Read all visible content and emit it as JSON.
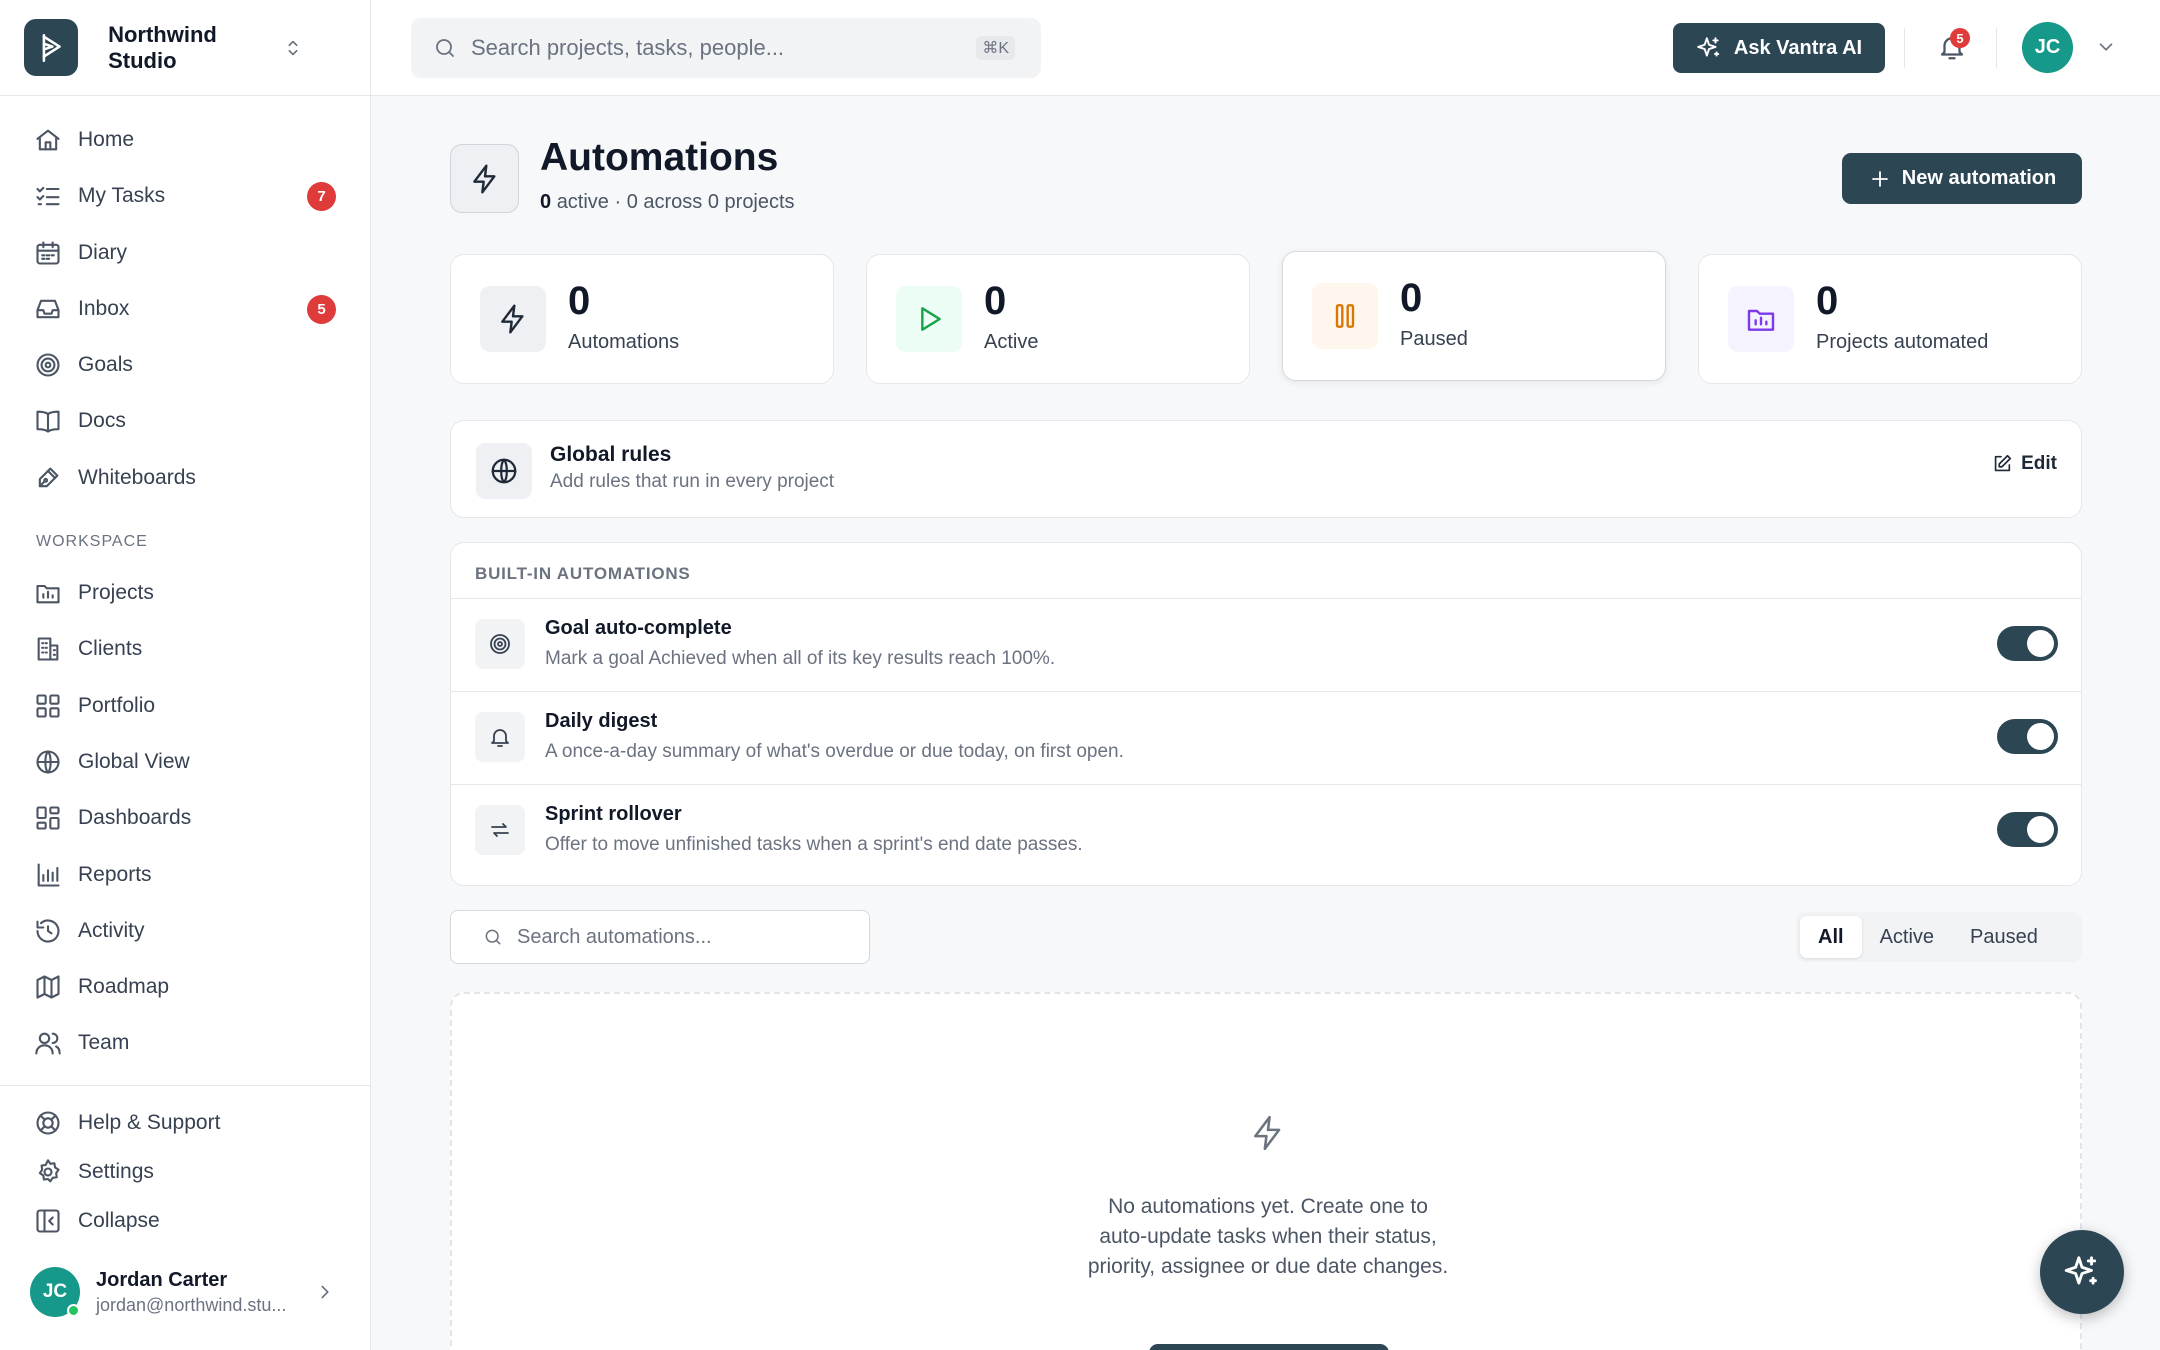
{
  "workspace": {
    "name": "Northwind Studio"
  },
  "nav": {
    "items": [
      {
        "label": "Home",
        "icon": "home-icon"
      },
      {
        "label": "My Tasks",
        "icon": "list-check-icon",
        "badge": "7"
      },
      {
        "label": "Diary",
        "icon": "calendar-icon"
      },
      {
        "label": "Inbox",
        "icon": "inbox-icon",
        "badge": "5"
      },
      {
        "label": "Goals",
        "icon": "target-icon"
      },
      {
        "label": "Docs",
        "icon": "book-icon"
      },
      {
        "label": "Whiteboards",
        "icon": "pen-icon"
      }
    ],
    "section_title": "WORKSPACE",
    "workspace_items": [
      {
        "label": "Projects",
        "icon": "folder-chart-icon"
      },
      {
        "label": "Clients",
        "icon": "building-icon"
      },
      {
        "label": "Portfolio",
        "icon": "grid-icon"
      },
      {
        "label": "Global View",
        "icon": "globe-icon"
      },
      {
        "label": "Dashboards",
        "icon": "dashboard-icon"
      },
      {
        "label": "Reports",
        "icon": "bar-chart-icon"
      },
      {
        "label": "Activity",
        "icon": "history-icon"
      },
      {
        "label": "Roadmap",
        "icon": "map-icon"
      },
      {
        "label": "Team",
        "icon": "users-icon"
      }
    ],
    "footer_items": [
      {
        "label": "Help & Support",
        "icon": "lifebuoy-icon"
      },
      {
        "label": "Settings",
        "icon": "gear-icon"
      },
      {
        "label": "Collapse",
        "icon": "collapse-sidebar-icon"
      }
    ]
  },
  "user": {
    "initials": "JC",
    "name": "Jordan Carter",
    "email": "jordan@northwind.stu..."
  },
  "header": {
    "search_placeholder": "Search projects, tasks, people...",
    "search_shortcut": "⌘K",
    "ai_button": "Ask Vantra AI",
    "notifications_count": "5",
    "avatar_initials": "JC"
  },
  "page": {
    "title": "Automations",
    "subtitle_count": "0",
    "subtitle_rest": "active · 0 across 0 projects",
    "new_button": "New automation"
  },
  "stats": [
    {
      "value": "0",
      "label": "Automations",
      "icon": "bolt-icon"
    },
    {
      "value": "0",
      "label": "Active",
      "icon": "play-icon"
    },
    {
      "value": "0",
      "label": "Paused",
      "icon": "pause-icon"
    },
    {
      "value": "0",
      "label": "Projects automated",
      "icon": "folder-chart-icon"
    }
  ],
  "global_rules": {
    "title": "Global rules",
    "subtitle": "Add rules that run in every project",
    "edit_label": "Edit"
  },
  "builtin": {
    "heading": "BUILT-IN AUTOMATIONS",
    "items": [
      {
        "title": "Goal auto-complete",
        "desc": "Mark a goal Achieved when all of its key results reach 100%.",
        "icon": "target-icon",
        "enabled": true
      },
      {
        "title": "Daily digest",
        "desc": "A once-a-day summary of what's overdue or due today, on first open.",
        "icon": "bell-icon",
        "enabled": true
      },
      {
        "title": "Sprint rollover",
        "desc": "Offer to move unfinished tasks when a sprint's end date passes.",
        "icon": "repeat-icon",
        "enabled": true
      }
    ]
  },
  "list": {
    "search_placeholder": "Search automations...",
    "filters": [
      "All",
      "Active",
      "Paused"
    ],
    "selected_filter": "All"
  },
  "empty_state": {
    "line1": "No automations yet. Create one to",
    "line2": "auto-update tasks when their status,",
    "line3": "priority, assignee or due date changes."
  },
  "colors": {
    "primary": "#2d4654",
    "badge": "#e03b3b",
    "avatar": "#16998a",
    "active_tint": "#ecfdf5",
    "paused_tint": "#fff7ed",
    "projects_tint": "#f5f3ff"
  }
}
